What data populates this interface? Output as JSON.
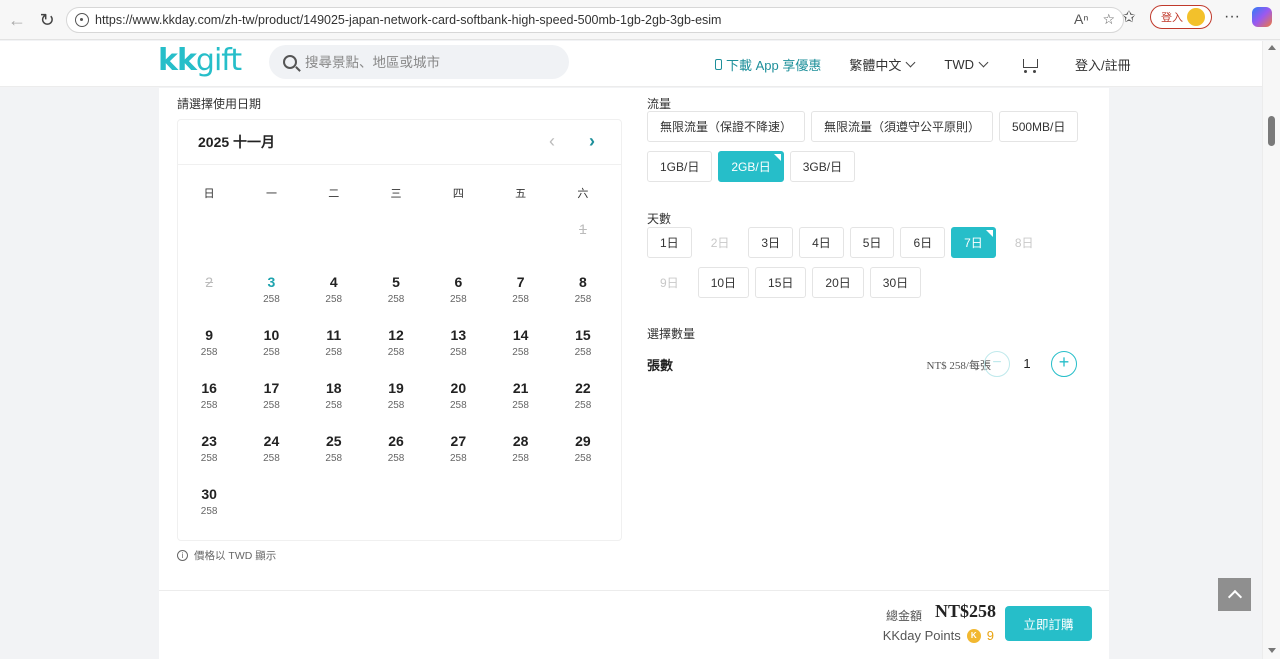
{
  "browser": {
    "url": "https://www.kkday.com/zh-tw/product/149025-japan-network-card-softbank-high-speed-500mb-1gb-2gb-3gb-esim",
    "login_label": "登入",
    "icons": [
      "back-icon",
      "refresh-icon",
      "lock-icon",
      "read-aloud-icon",
      "favorite-star-icon",
      "favorites-icon",
      "more-icon",
      "copilot-icon"
    ]
  },
  "header": {
    "logo_kk": "kk",
    "logo_gift": "gift",
    "search_placeholder": "搜尋景點、地區或城市",
    "app_link": "下載 App 享優惠",
    "language": "繁體中文",
    "currency": "TWD",
    "login": "登入/註冊"
  },
  "calendar": {
    "section_label": "請選擇使用日期",
    "month": "2025 十一月",
    "weekdays": [
      "日",
      "一",
      "二",
      "三",
      "四",
      "五",
      "六"
    ],
    "leading_blanks": 6,
    "days": [
      {
        "num": "1",
        "price": "",
        "state": "disabled"
      },
      {
        "num": "2",
        "price": "",
        "state": "disabled"
      },
      {
        "num": "3",
        "price": "258",
        "state": "today"
      },
      {
        "num": "4",
        "price": "258",
        "state": "normal"
      },
      {
        "num": "5",
        "price": "258",
        "state": "normal"
      },
      {
        "num": "6",
        "price": "258",
        "state": "normal"
      },
      {
        "num": "7",
        "price": "258",
        "state": "normal"
      },
      {
        "num": "8",
        "price": "258",
        "state": "normal"
      },
      {
        "num": "9",
        "price": "258",
        "state": "normal"
      },
      {
        "num": "10",
        "price": "258",
        "state": "normal"
      },
      {
        "num": "11",
        "price": "258",
        "state": "normal"
      },
      {
        "num": "12",
        "price": "258",
        "state": "normal"
      },
      {
        "num": "13",
        "price": "258",
        "state": "normal"
      },
      {
        "num": "14",
        "price": "258",
        "state": "normal"
      },
      {
        "num": "15",
        "price": "258",
        "state": "normal"
      },
      {
        "num": "16",
        "price": "258",
        "state": "normal"
      },
      {
        "num": "17",
        "price": "258",
        "state": "normal"
      },
      {
        "num": "18",
        "price": "258",
        "state": "normal"
      },
      {
        "num": "19",
        "price": "258",
        "state": "normal"
      },
      {
        "num": "20",
        "price": "258",
        "state": "normal"
      },
      {
        "num": "21",
        "price": "258",
        "state": "normal"
      },
      {
        "num": "22",
        "price": "258",
        "state": "normal"
      },
      {
        "num": "23",
        "price": "258",
        "state": "normal"
      },
      {
        "num": "24",
        "price": "258",
        "state": "normal"
      },
      {
        "num": "25",
        "price": "258",
        "state": "normal"
      },
      {
        "num": "26",
        "price": "258",
        "state": "normal"
      },
      {
        "num": "27",
        "price": "258",
        "state": "normal"
      },
      {
        "num": "28",
        "price": "258",
        "state": "normal"
      },
      {
        "num": "29",
        "price": "258",
        "state": "normal"
      },
      {
        "num": "30",
        "price": "258",
        "state": "normal"
      }
    ],
    "price_note": "價格以 TWD 顯示"
  },
  "options": {
    "data_label": "流量",
    "data_row1": [
      {
        "label": "無限流量（保證不降速）",
        "state": "normal"
      },
      {
        "label": "無限流量（須遵守公平原則）",
        "state": "normal"
      },
      {
        "label": "500MB/日",
        "state": "normal"
      }
    ],
    "data_row2": [
      {
        "label": "1GB/日",
        "state": "normal"
      },
      {
        "label": "2GB/日",
        "state": "selected"
      },
      {
        "label": "3GB/日",
        "state": "normal"
      }
    ],
    "days_label": "天數",
    "days_row1": [
      {
        "label": "1日",
        "state": "normal"
      },
      {
        "label": "2日",
        "state": "disabled"
      },
      {
        "label": "3日",
        "state": "normal"
      },
      {
        "label": "4日",
        "state": "normal"
      },
      {
        "label": "5日",
        "state": "normal"
      },
      {
        "label": "6日",
        "state": "normal"
      },
      {
        "label": "7日",
        "state": "selected"
      },
      {
        "label": "8日",
        "state": "disabled"
      }
    ],
    "days_row2": [
      {
        "label": "9日",
        "state": "disabled"
      },
      {
        "label": "10日",
        "state": "normal"
      },
      {
        "label": "15日",
        "state": "normal"
      },
      {
        "label": "20日",
        "state": "normal"
      },
      {
        "label": "30日",
        "state": "normal"
      }
    ]
  },
  "quantity": {
    "title": "選擇數量",
    "item_name": "張數",
    "unit_price": "NT$ 258/每張",
    "minus": "−",
    "value": "1",
    "plus": "+"
  },
  "footer": {
    "total_label": "總金額",
    "total_value": "NT$258",
    "points_label": "KKday Points",
    "points_value": "9",
    "coin": "K",
    "book_label": "立即訂購"
  },
  "colors": {
    "accent": "#26bec9",
    "accent_dark": "#1d8f9a",
    "points": "#e9a412"
  }
}
